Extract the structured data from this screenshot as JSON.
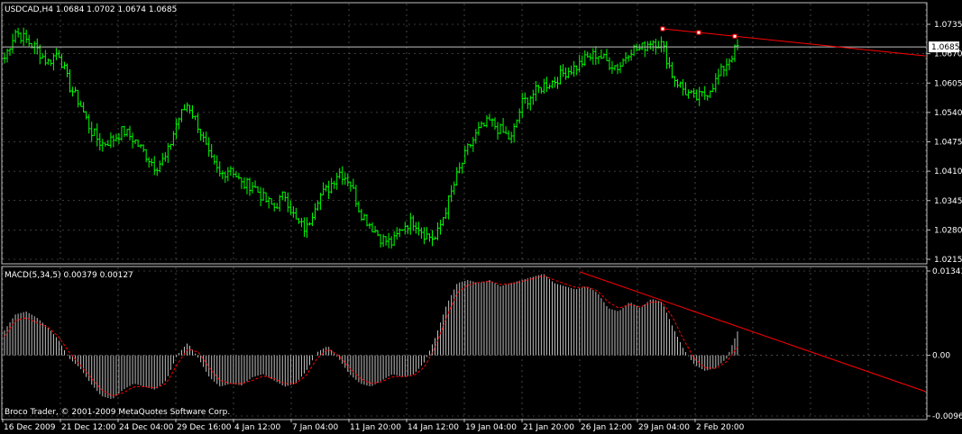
{
  "colors": {
    "background": "#000000",
    "frame": "#c0c0c0",
    "grid": "#c0c0c0",
    "bar_up": "#00ff00",
    "bar_down": "#00ff00",
    "trendline": "#ff0000",
    "anchor": "#ffffff",
    "hist": "#c0c0c0",
    "signal": "#ff0000",
    "text": "#ffffff",
    "price_tag_bg": "#ffffff",
    "price_tag_text": "#000000"
  },
  "main_panel": {
    "header": "USDCAD,H4  1.0684 1.0702 1.0674 1.0685",
    "price_tag": "1.0685",
    "y_labels": [
      "1.0735",
      "1.0670",
      "1.0605",
      "1.0540",
      "1.0475",
      "1.0410",
      "1.0345",
      "1.0280",
      "1.0215"
    ]
  },
  "sub_panel": {
    "header": "MACD(5,34,5) 0.00379 0.00127",
    "y_labels": [
      "0.01343",
      "0.00",
      "-0.00967"
    ],
    "footer": "Broco Trader, © 2001-2009 MetaQuotes Software Corp."
  },
  "x_labels": [
    "16 Dec 2009",
    "21 Dec 12:00",
    "24 Dec 04:00",
    "29 Dec 16:00",
    "4 Jan 12:00",
    "7 Jan 04:00",
    "11 Jan 20:00",
    "14 Jan 12:00",
    "19 Jan 04:00",
    "21 Jan 20:00",
    "26 Jan 12:00",
    "29 Jan 04:00",
    "2 Feb 20:00"
  ],
  "chart_data": [
    {
      "type": "bar",
      "symbol": "USDCAD",
      "timeframe": "H4",
      "ylim": [
        1.0215,
        1.0735
      ],
      "current_ohlc": {
        "open": 1.0684,
        "high": 1.0702,
        "low": 1.0674,
        "close": 1.0685
      },
      "close_path": [
        1.066,
        1.072,
        1.07,
        1.068,
        1.065,
        1.0675,
        1.06,
        1.056,
        1.05,
        1.047,
        1.048,
        1.05,
        1.048,
        1.045,
        1.042,
        1.044,
        1.052,
        1.056,
        1.051,
        1.044,
        1.04,
        1.042,
        1.038,
        1.038,
        1.035,
        1.033,
        1.036,
        1.03,
        1.028,
        1.035,
        1.037,
        1.041,
        1.039,
        1.032,
        1.029,
        1.026,
        1.025,
        1.029,
        1.03,
        1.027,
        1.026,
        1.033,
        1.04,
        1.046,
        1.05,
        1.052,
        1.05,
        1.048,
        1.056,
        1.058,
        1.06,
        1.061,
        1.063,
        1.064,
        1.066,
        1.067,
        1.065,
        1.064,
        1.068,
        1.068,
        1.07,
        1.069,
        1.062,
        1.059,
        1.057,
        1.058,
        1.061,
        1.065,
        1.0685
      ],
      "trendline": {
        "from": {
          "date": "29 Jan",
          "value": 1.0725
        },
        "to": {
          "date": "beyond 2 Feb 20:00",
          "value": 1.0665
        },
        "anchors": 3
      }
    },
    {
      "type": "bar",
      "indicator": "MACD(5,34,5)",
      "ylim": [
        -0.00967,
        0.01343
      ],
      "main_value": 0.00379,
      "signal_value": 0.00127,
      "histogram_path": [
        0.004,
        0.0065,
        0.007,
        0.006,
        0.0045,
        0.0025,
        -0.0005,
        -0.002,
        -0.0045,
        -0.0065,
        -0.007,
        -0.0055,
        -0.0045,
        -0.005,
        -0.0055,
        -0.004,
        0.0,
        0.002,
        -0.0005,
        -0.0035,
        -0.005,
        -0.0045,
        -0.0048,
        -0.0035,
        -0.003,
        -0.004,
        -0.005,
        -0.0045,
        -0.0025,
        0.0005,
        0.0015,
        -0.0005,
        -0.003,
        -0.0045,
        -0.005,
        -0.004,
        -0.003,
        -0.0035,
        -0.003,
        -0.001,
        0.003,
        0.008,
        0.0115,
        0.012,
        0.0115,
        0.012,
        0.011,
        0.0115,
        0.012,
        0.0125,
        0.013,
        0.0115,
        0.011,
        0.0105,
        0.011,
        0.01,
        0.0075,
        0.007,
        0.0085,
        0.0075,
        0.009,
        0.0085,
        0.0045,
        0.001,
        -0.0015,
        -0.0025,
        -0.002,
        -0.0005,
        0.0038
      ],
      "signal_path": [
        0.003,
        0.0055,
        0.006,
        0.0052,
        0.0045,
        0.003,
        0.0005,
        -0.0015,
        -0.0035,
        -0.0055,
        -0.0065,
        -0.006,
        -0.005,
        -0.005,
        -0.0052,
        -0.0045,
        -0.0015,
        0.001,
        0.0005,
        -0.002,
        -0.004,
        -0.0045,
        -0.0045,
        -0.004,
        -0.0033,
        -0.0037,
        -0.0045,
        -0.0045,
        -0.0032,
        -0.0005,
        0.001,
        0.0,
        -0.002,
        -0.0037,
        -0.0045,
        -0.0042,
        -0.0034,
        -0.0034,
        -0.0032,
        -0.0018,
        0.0015,
        0.006,
        0.01,
        0.0112,
        0.0116,
        0.0118,
        0.0113,
        0.0114,
        0.0118,
        0.0122,
        0.0127,
        0.012,
        0.0114,
        0.0108,
        0.0109,
        0.0103,
        0.0085,
        0.0075,
        0.0081,
        0.0077,
        0.0085,
        0.0085,
        0.006,
        0.0025,
        -0.0005,
        -0.002,
        -0.0021,
        -0.001,
        0.0013
      ],
      "trendline": {
        "from": {
          "date": "26 Jan 12:00",
          "value": 0.0133
        },
        "to": {
          "date": "beyond 2 Feb 20:00",
          "value": -0.0058
        }
      }
    }
  ]
}
